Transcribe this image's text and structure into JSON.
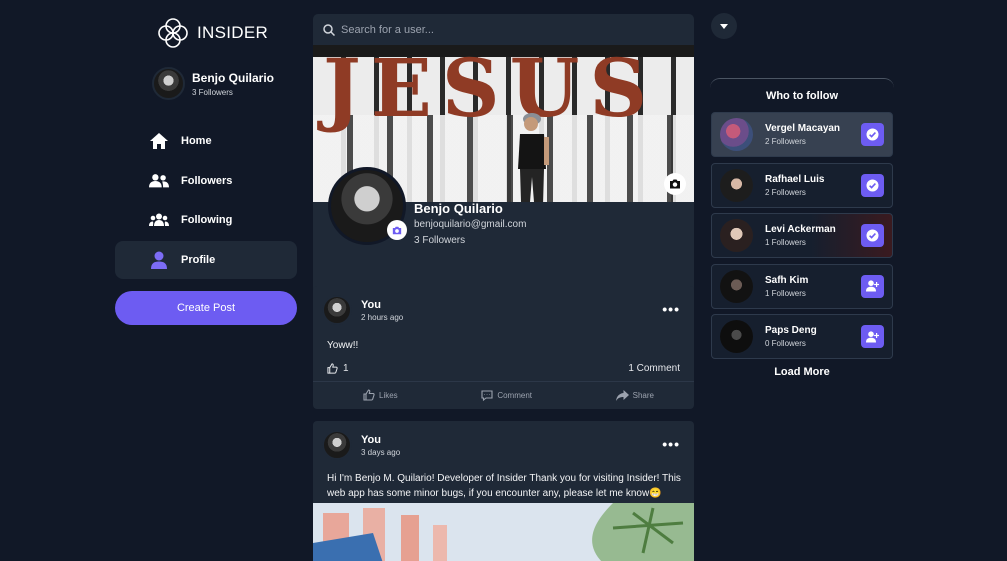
{
  "app": {
    "brand_name": "INSIDER"
  },
  "current_user": {
    "name": "Benjo Quilario",
    "followers": "3 Followers"
  },
  "nav": {
    "items": [
      {
        "label": "Home",
        "icon": "home-icon"
      },
      {
        "label": "Followers",
        "icon": "followers-icon"
      },
      {
        "label": "Following",
        "icon": "following-icon"
      },
      {
        "label": "Profile",
        "icon": "profile-icon",
        "active": true
      }
    ],
    "create_post_label": "Create Post"
  },
  "search": {
    "placeholder": "Search for a user...",
    "value": ""
  },
  "cover": {
    "text": "JESUS"
  },
  "profile": {
    "name": "Benjo Quilario",
    "email": "benjoquilario@gmail.com",
    "followers": "3 Followers"
  },
  "posts": [
    {
      "author": "You",
      "time": "2 hours ago",
      "text": "Yoww!!",
      "likes": "1",
      "comments": "1 Comment",
      "actions": {
        "like": "Likes",
        "comment": "Comment",
        "share": "Share"
      }
    },
    {
      "author": "You",
      "time": "3 days ago",
      "text": "Hi I'm Benjo M. Quilario! Developer of Insider  Thank you for visiting Insider! This web app has some minor bugs, if you encounter any, please let me know😁"
    }
  ],
  "who_to_follow": {
    "title": "Who to follow",
    "users": [
      {
        "name": "Vergel Macayan",
        "followers": "2 Followers",
        "following": true
      },
      {
        "name": "Rafhael Luis",
        "followers": "2 Followers",
        "following": true
      },
      {
        "name": "Levi Ackerman",
        "followers": "1 Followers",
        "following": true
      },
      {
        "name": "Safh Kim",
        "followers": "1 Followers",
        "following": false
      },
      {
        "name": "Paps Deng",
        "followers": "0 Followers",
        "following": false
      }
    ],
    "load_more_label": "Load More"
  },
  "colors": {
    "background": "#111827",
    "card": "#1f2937",
    "accent": "#6d5cf2"
  }
}
